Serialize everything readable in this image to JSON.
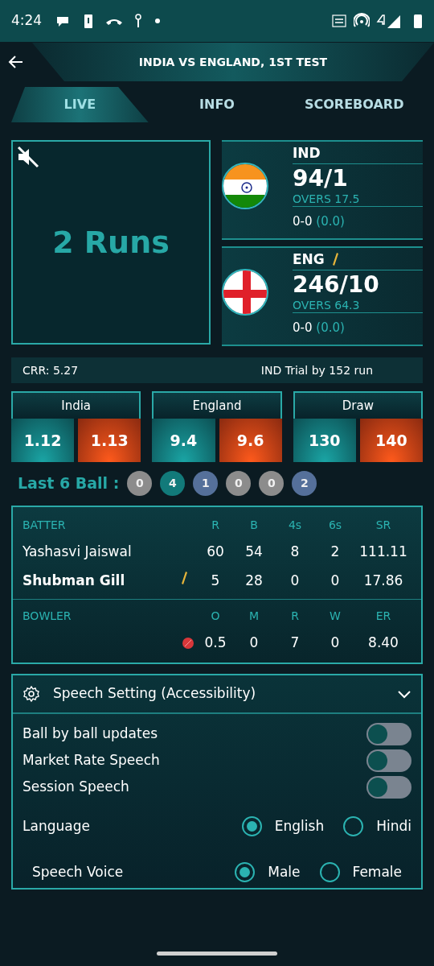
{
  "status_bar": {
    "time": "4:24"
  },
  "header": {
    "title": "INDIA VS ENGLAND, 1ST TEST"
  },
  "tabs": [
    {
      "label": "LIVE",
      "selected": true
    },
    {
      "label": "INFO",
      "selected": false
    },
    {
      "label": "SCOREBOARD",
      "selected": false
    }
  ],
  "commentary": {
    "muted": true,
    "text": "2 Runs"
  },
  "teams": [
    {
      "code": "IND",
      "batting": false,
      "score": "94/1",
      "overs": "OVERS 17.5",
      "session": "0-0",
      "session_rate": "(0.0)"
    },
    {
      "code": "ENG",
      "batting": true,
      "score": "246/10",
      "overs": "OVERS 64.3",
      "session": "0-0",
      "session_rate": "(0.0)"
    }
  ],
  "summary": {
    "crr": "CRR: 5.27",
    "status": "IND Trial by 152 run"
  },
  "markets": [
    {
      "name": "India",
      "back": "1.12",
      "lay": "1.13"
    },
    {
      "name": "England",
      "back": "9.4",
      "lay": "9.6"
    },
    {
      "name": "Draw",
      "back": "130",
      "lay": "140"
    }
  ],
  "last_balls": {
    "label": "Last 6 Ball :",
    "balls": [
      {
        "value": "0",
        "color": "#8c8c8c"
      },
      {
        "value": "4",
        "color": "#127a7a"
      },
      {
        "value": "1",
        "color": "#55709a"
      },
      {
        "value": "0",
        "color": "#8c8c8c"
      },
      {
        "value": "0",
        "color": "#8c8c8c"
      },
      {
        "value": "2",
        "color": "#55709a"
      }
    ]
  },
  "batting": {
    "columns": [
      "BATTER",
      "R",
      "B",
      "4s",
      "6s",
      "SR"
    ],
    "rows": [
      {
        "name": "Yashasvi Jaiswal",
        "on_strike": false,
        "values": [
          "60",
          "54",
          "8",
          "2",
          "111.11"
        ]
      },
      {
        "name": "Shubman Gill",
        "on_strike": true,
        "values": [
          "5",
          "28",
          "0",
          "0",
          "17.86"
        ]
      }
    ]
  },
  "bowling": {
    "columns": [
      "BOWLER",
      "O",
      "M",
      "R",
      "W",
      "ER"
    ],
    "rows": [
      {
        "bowling": true,
        "values": [
          "0.5",
          "0",
          "7",
          "0",
          "8.40"
        ]
      }
    ]
  },
  "speech": {
    "title": "Speech Setting (Accessibility)",
    "expanded": true,
    "toggles": [
      {
        "label": "Ball by ball updates",
        "on": false
      },
      {
        "label": "Market Rate Speech",
        "on": false
      },
      {
        "label": "Session Speech",
        "on": false
      }
    ],
    "options": [
      {
        "label": "Language",
        "choices": [
          {
            "label": "English",
            "selected": true
          },
          {
            "label": "Hindi",
            "selected": false
          }
        ]
      },
      {
        "label": "Speech Voice",
        "choices": [
          {
            "label": "Male",
            "selected": true
          },
          {
            "label": "Female",
            "selected": false
          }
        ]
      }
    ]
  }
}
